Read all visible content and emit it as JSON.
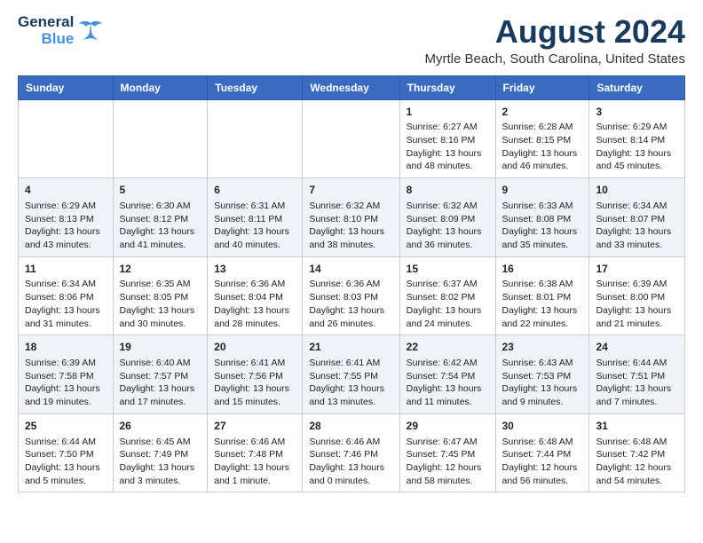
{
  "logo": {
    "line1": "General",
    "line2": "Blue"
  },
  "title": "August 2024",
  "subtitle": "Myrtle Beach, South Carolina, United States",
  "days_of_week": [
    "Sunday",
    "Monday",
    "Tuesday",
    "Wednesday",
    "Thursday",
    "Friday",
    "Saturday"
  ],
  "weeks": [
    [
      {
        "day": "",
        "info": ""
      },
      {
        "day": "",
        "info": ""
      },
      {
        "day": "",
        "info": ""
      },
      {
        "day": "",
        "info": ""
      },
      {
        "day": "1",
        "info": "Sunrise: 6:27 AM\nSunset: 8:16 PM\nDaylight: 13 hours\nand 48 minutes."
      },
      {
        "day": "2",
        "info": "Sunrise: 6:28 AM\nSunset: 8:15 PM\nDaylight: 13 hours\nand 46 minutes."
      },
      {
        "day": "3",
        "info": "Sunrise: 6:29 AM\nSunset: 8:14 PM\nDaylight: 13 hours\nand 45 minutes."
      }
    ],
    [
      {
        "day": "4",
        "info": "Sunrise: 6:29 AM\nSunset: 8:13 PM\nDaylight: 13 hours\nand 43 minutes."
      },
      {
        "day": "5",
        "info": "Sunrise: 6:30 AM\nSunset: 8:12 PM\nDaylight: 13 hours\nand 41 minutes."
      },
      {
        "day": "6",
        "info": "Sunrise: 6:31 AM\nSunset: 8:11 PM\nDaylight: 13 hours\nand 40 minutes."
      },
      {
        "day": "7",
        "info": "Sunrise: 6:32 AM\nSunset: 8:10 PM\nDaylight: 13 hours\nand 38 minutes."
      },
      {
        "day": "8",
        "info": "Sunrise: 6:32 AM\nSunset: 8:09 PM\nDaylight: 13 hours\nand 36 minutes."
      },
      {
        "day": "9",
        "info": "Sunrise: 6:33 AM\nSunset: 8:08 PM\nDaylight: 13 hours\nand 35 minutes."
      },
      {
        "day": "10",
        "info": "Sunrise: 6:34 AM\nSunset: 8:07 PM\nDaylight: 13 hours\nand 33 minutes."
      }
    ],
    [
      {
        "day": "11",
        "info": "Sunrise: 6:34 AM\nSunset: 8:06 PM\nDaylight: 13 hours\nand 31 minutes."
      },
      {
        "day": "12",
        "info": "Sunrise: 6:35 AM\nSunset: 8:05 PM\nDaylight: 13 hours\nand 30 minutes."
      },
      {
        "day": "13",
        "info": "Sunrise: 6:36 AM\nSunset: 8:04 PM\nDaylight: 13 hours\nand 28 minutes."
      },
      {
        "day": "14",
        "info": "Sunrise: 6:36 AM\nSunset: 8:03 PM\nDaylight: 13 hours\nand 26 minutes."
      },
      {
        "day": "15",
        "info": "Sunrise: 6:37 AM\nSunset: 8:02 PM\nDaylight: 13 hours\nand 24 minutes."
      },
      {
        "day": "16",
        "info": "Sunrise: 6:38 AM\nSunset: 8:01 PM\nDaylight: 13 hours\nand 22 minutes."
      },
      {
        "day": "17",
        "info": "Sunrise: 6:39 AM\nSunset: 8:00 PM\nDaylight: 13 hours\nand 21 minutes."
      }
    ],
    [
      {
        "day": "18",
        "info": "Sunrise: 6:39 AM\nSunset: 7:58 PM\nDaylight: 13 hours\nand 19 minutes."
      },
      {
        "day": "19",
        "info": "Sunrise: 6:40 AM\nSunset: 7:57 PM\nDaylight: 13 hours\nand 17 minutes."
      },
      {
        "day": "20",
        "info": "Sunrise: 6:41 AM\nSunset: 7:56 PM\nDaylight: 13 hours\nand 15 minutes."
      },
      {
        "day": "21",
        "info": "Sunrise: 6:41 AM\nSunset: 7:55 PM\nDaylight: 13 hours\nand 13 minutes."
      },
      {
        "day": "22",
        "info": "Sunrise: 6:42 AM\nSunset: 7:54 PM\nDaylight: 13 hours\nand 11 minutes."
      },
      {
        "day": "23",
        "info": "Sunrise: 6:43 AM\nSunset: 7:53 PM\nDaylight: 13 hours\nand 9 minutes."
      },
      {
        "day": "24",
        "info": "Sunrise: 6:44 AM\nSunset: 7:51 PM\nDaylight: 13 hours\nand 7 minutes."
      }
    ],
    [
      {
        "day": "25",
        "info": "Sunrise: 6:44 AM\nSunset: 7:50 PM\nDaylight: 13 hours\nand 5 minutes."
      },
      {
        "day": "26",
        "info": "Sunrise: 6:45 AM\nSunset: 7:49 PM\nDaylight: 13 hours\nand 3 minutes."
      },
      {
        "day": "27",
        "info": "Sunrise: 6:46 AM\nSunset: 7:48 PM\nDaylight: 13 hours\nand 1 minute."
      },
      {
        "day": "28",
        "info": "Sunrise: 6:46 AM\nSunset: 7:46 PM\nDaylight: 13 hours\nand 0 minutes."
      },
      {
        "day": "29",
        "info": "Sunrise: 6:47 AM\nSunset: 7:45 PM\nDaylight: 12 hours\nand 58 minutes."
      },
      {
        "day": "30",
        "info": "Sunrise: 6:48 AM\nSunset: 7:44 PM\nDaylight: 12 hours\nand 56 minutes."
      },
      {
        "day": "31",
        "info": "Sunrise: 6:48 AM\nSunset: 7:42 PM\nDaylight: 12 hours\nand 54 minutes."
      }
    ]
  ]
}
